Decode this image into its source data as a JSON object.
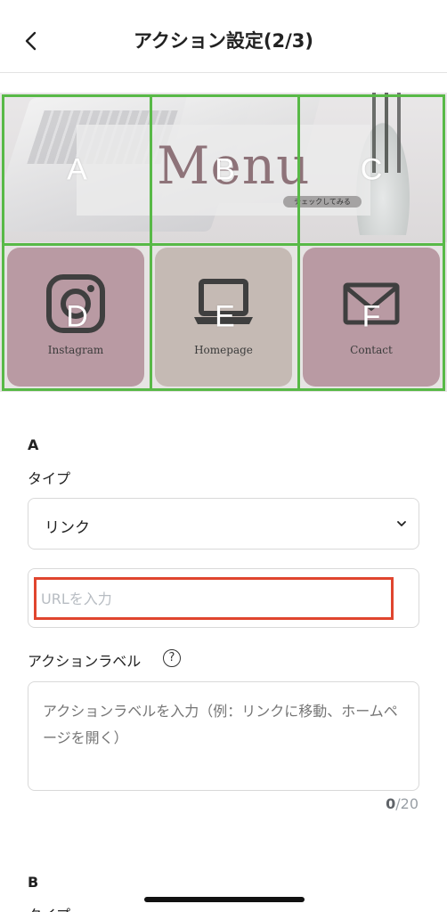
{
  "header": {
    "back_icon": "chevron-left-icon",
    "title": "アクション設定(2/3)"
  },
  "imagemap": {
    "menu_text": "Menu",
    "check_pill": "チェックしてみる",
    "tiles": [
      {
        "label": "Instagram",
        "icon": "instagram-icon"
      },
      {
        "label": "Homepage",
        "icon": "laptop-icon"
      },
      {
        "label": "Contact",
        "icon": "envelope-icon"
      }
    ],
    "regions": [
      "A",
      "B",
      "C",
      "D",
      "E",
      "F"
    ],
    "grid_color": "#58b947"
  },
  "section_a": {
    "title": "A",
    "type_label": "タイプ",
    "type_value": "リンク",
    "url_placeholder": "URLを入力",
    "action_label": "アクションラベル",
    "action_help_icon": "question-circle-icon",
    "action_placeholder": "アクションラベルを入力（例：リンクに移動、ホームページを開く）",
    "counter_current": "0",
    "counter_max": "/20"
  },
  "section_b": {
    "title": "B",
    "type_label": "タイプ"
  },
  "colors": {
    "highlight": "#e0452e",
    "tile_mauve": "#b99aa3",
    "tile_beige": "#c5bab4"
  }
}
